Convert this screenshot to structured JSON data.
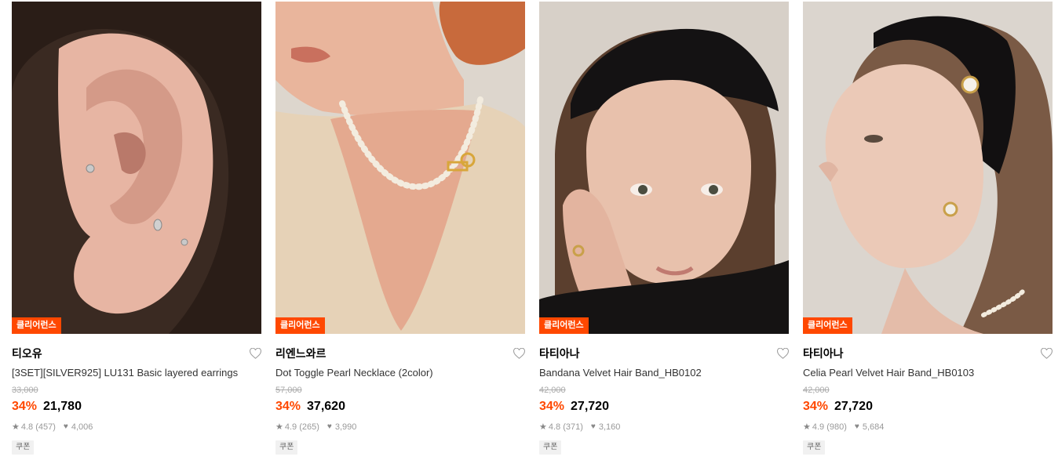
{
  "badge_label": "클리어런스",
  "coupon_label": "쿠폰",
  "colors": {
    "accent": "#ff4800"
  },
  "products": [
    {
      "brand": "티오유",
      "name": "[3SET][SILVER925] LU131 Basic layered earrings",
      "original_price": "33,000",
      "discount": "34%",
      "price": "21,780",
      "rating": "4.8 (457)",
      "likes": "4,006"
    },
    {
      "brand": "리엔느와르",
      "name": "Dot Toggle Pearl Necklace (2color)",
      "original_price": "57,000",
      "discount": "34%",
      "price": "37,620",
      "rating": "4.9 (265)",
      "likes": "3,990"
    },
    {
      "brand": "타티아나",
      "name": "Bandana Velvet Hair Band_HB0102",
      "original_price": "42,000",
      "discount": "34%",
      "price": "27,720",
      "rating": "4.8 (371)",
      "likes": "3,160"
    },
    {
      "brand": "타티아나",
      "name": "Celia Pearl Velvet Hair Band_HB0103",
      "original_price": "42,000",
      "discount": "34%",
      "price": "27,720",
      "rating": "4.9 (980)",
      "likes": "5,684"
    }
  ]
}
